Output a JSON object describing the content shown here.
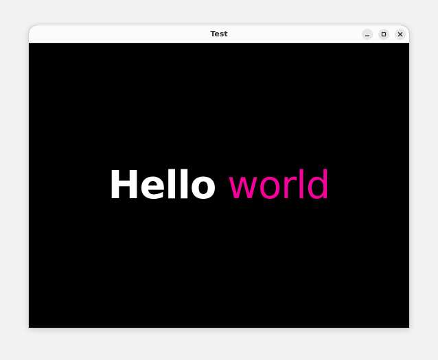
{
  "window": {
    "title": "Test",
    "controls": {
      "minimize_icon": "minimize-icon",
      "maximize_icon": "maximize-icon",
      "close_icon": "close-icon"
    }
  },
  "content": {
    "greeting_word1": "Hello",
    "greeting_word2": "world",
    "greeting_word1_color": "#ffffff",
    "greeting_word2_color": "#f5009b",
    "background_color": "#000000"
  }
}
